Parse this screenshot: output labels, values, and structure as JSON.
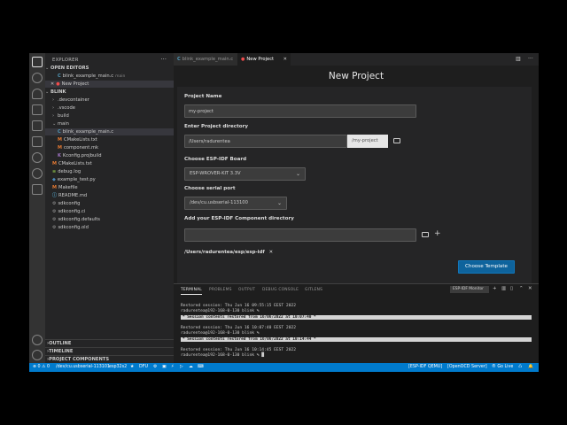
{
  "activity_bar": {
    "icons": [
      "files-icon",
      "search-icon",
      "source-control-icon",
      "run-debug-icon",
      "extensions-icon",
      "remote-explorer-icon",
      "testing-icon",
      "esp-idf-icon",
      "docker-icon"
    ]
  },
  "sidebar": {
    "header": "EXPLORER",
    "open_editors_title": "OPEN EDITORS",
    "open_editors": [
      {
        "name": "blink_example_main.c",
        "detail": "main"
      },
      {
        "name": "New Project",
        "detail": ""
      }
    ],
    "workspace_title": "BLINK",
    "files": [
      {
        "name": ".devcontainer",
        "kind": "folder",
        "depth": 1
      },
      {
        "name": ".vscode",
        "kind": "folder",
        "depth": 1
      },
      {
        "name": "build",
        "kind": "folder",
        "depth": 1
      },
      {
        "name": "main",
        "kind": "folder-open",
        "depth": 1
      },
      {
        "name": "blink_example_main.c",
        "kind": "c",
        "depth": 2,
        "selected": true
      },
      {
        "name": "CMakeLists.txt",
        "kind": "m",
        "depth": 2
      },
      {
        "name": "component.mk",
        "kind": "m",
        "depth": 2
      },
      {
        "name": "Kconfig.projbuild",
        "kind": "k",
        "depth": 2
      },
      {
        "name": "CMakeLists.txt",
        "kind": "m",
        "depth": 1
      },
      {
        "name": "debug.log",
        "kind": "g",
        "depth": 1
      },
      {
        "name": "example_test.py",
        "kind": "py",
        "depth": 1
      },
      {
        "name": "Makefile",
        "kind": "m",
        "depth": 1
      },
      {
        "name": "README.md",
        "kind": "md",
        "depth": 1
      },
      {
        "name": "sdkconfig",
        "kind": "gear",
        "depth": 1
      },
      {
        "name": "sdkconfig.ci",
        "kind": "gear",
        "depth": 1
      },
      {
        "name": "sdkconfig.defaults",
        "kind": "gear",
        "depth": 1
      },
      {
        "name": "sdkconfig.old",
        "kind": "gear",
        "depth": 1
      }
    ],
    "bottom_sections": [
      "OUTLINE",
      "TIMELINE",
      "PROJECT COMPONENTS"
    ]
  },
  "tabs": [
    {
      "label": "blink_example_main.c"
    },
    {
      "label": "New Project"
    }
  ],
  "form": {
    "title": "New Project",
    "project_name_label": "Project Name",
    "project_name_value": "my-project",
    "directory_label": "Enter Project directory",
    "directory_value": "/Users/radurentea",
    "directory_suffix": "/my-project",
    "board_label": "Choose ESP-IDF Board",
    "board_value": "ESP-WROVER-KIT 3.3V",
    "port_label": "Choose serial port",
    "port_value": "/dev/cu.usbserial-113100",
    "component_label": "Add your ESP-IDF Component directory",
    "component_value": "",
    "component_path": "/Users/radurentea/esp/esp-idf",
    "choose_button": "Choose Template"
  },
  "panel": {
    "tabs": [
      "TERMINAL",
      "PROBLEMS",
      "OUTPUT",
      "DEBUG CONSOLE",
      "GITLENS"
    ],
    "terminal_selector": "ESP-IDF Monitor",
    "lines": [
      {
        "kind": "text",
        "text": "Restored session: Thu Jun 16 09:55:15 EEST 2022"
      },
      {
        "kind": "text",
        "text": "radurentea@192-168-0-130 blink %"
      },
      {
        "kind": "bar",
        "text": "* Session contents restored from 16/06/2022 at 10:07:40 *"
      },
      {
        "kind": "text",
        "text": "Restored session: Thu Jun 16 10:07:40 EEST 2022"
      },
      {
        "kind": "text",
        "text": "radurentea@192-168-0-130 blink %"
      },
      {
        "kind": "bar",
        "text": "* Session contents restored from 16/06/2022 at 10:14:44 *"
      },
      {
        "kind": "text",
        "text": "Restored session: Thu Jun 16 10:14:45 EEST 2022"
      },
      {
        "kind": "text",
        "text": "radurentea@192-168-0-130 blink % █"
      }
    ]
  },
  "status_bar": {
    "items_left": [
      "⊗ 0  ⚠ 0",
      "/dev/cu.usbserial-113101",
      "esp32s2",
      "★",
      "DFU",
      "⚙",
      "▣",
      "⚡",
      "▷",
      "☁",
      "⌨"
    ],
    "items_right": [
      "[ESP-IDF QEMU]",
      "[OpenOCD Server]",
      "® Go Live",
      "♺",
      "🔔"
    ]
  },
  "colors": {
    "accent": "#007acc",
    "button": "#0e639c",
    "tab_close_dot": "#f14c4c"
  }
}
